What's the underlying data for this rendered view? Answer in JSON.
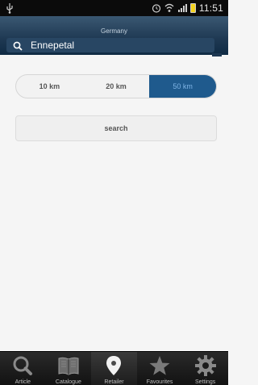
{
  "status_bar": {
    "time": "11:51",
    "icons": [
      "usb-icon",
      "alarm-icon",
      "wifi-icon",
      "signal-icon",
      "battery-icon"
    ]
  },
  "header": {
    "subtitle": "Germany",
    "search_value": "Ennepetal",
    "search_icon": "search-icon"
  },
  "distance": {
    "options": [
      "10 km",
      "20 km",
      "50 km"
    ],
    "selected": "50 km"
  },
  "search_button": {
    "label": "search"
  },
  "bottom_nav": {
    "items": [
      {
        "label": "Article",
        "icon": "search-icon"
      },
      {
        "label": "Catalogue",
        "icon": "book-icon"
      },
      {
        "label": "Retailer",
        "icon": "map-pin-icon"
      },
      {
        "label": "Favourites",
        "icon": "star-icon"
      },
      {
        "label": "Settings",
        "icon": "gear-icon"
      }
    ],
    "active": "Retailer"
  },
  "colors": {
    "header": "#1e3852",
    "accent": "#1f5a8d",
    "background": "#f5f5f5"
  }
}
